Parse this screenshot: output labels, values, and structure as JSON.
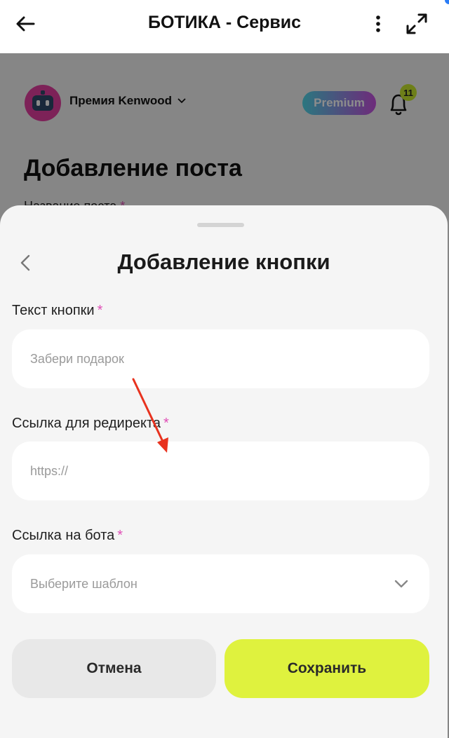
{
  "topbar": {
    "title": "БОТИКА - Сервис",
    "icons": [
      "arrow-left-icon",
      "kebab-menu-icon",
      "expand-icon"
    ]
  },
  "background": {
    "account_name": "Премия Kenwood",
    "premium_label": "Premium",
    "notification_count": "11",
    "page_heading": "Добавление поста",
    "peek_label": "Название поста",
    "peek_required": "*"
  },
  "sheet": {
    "title": "Добавление кнопки",
    "fields": [
      {
        "label": "Текст кнопки",
        "required": "*",
        "placeholder": "Забери подарок"
      },
      {
        "label": "Ссылка для редиректа",
        "required": "*",
        "placeholder": "https://"
      },
      {
        "label": "Ссылка на бота",
        "required": "*",
        "placeholder": "Выберите шаблон"
      }
    ],
    "cancel_label": "Отмена",
    "save_label": "Сохранить"
  },
  "colors": {
    "accent_save": "#dff23e",
    "required_asterisk": "#e04fb6",
    "annotation_arrow": "#e8321e"
  }
}
